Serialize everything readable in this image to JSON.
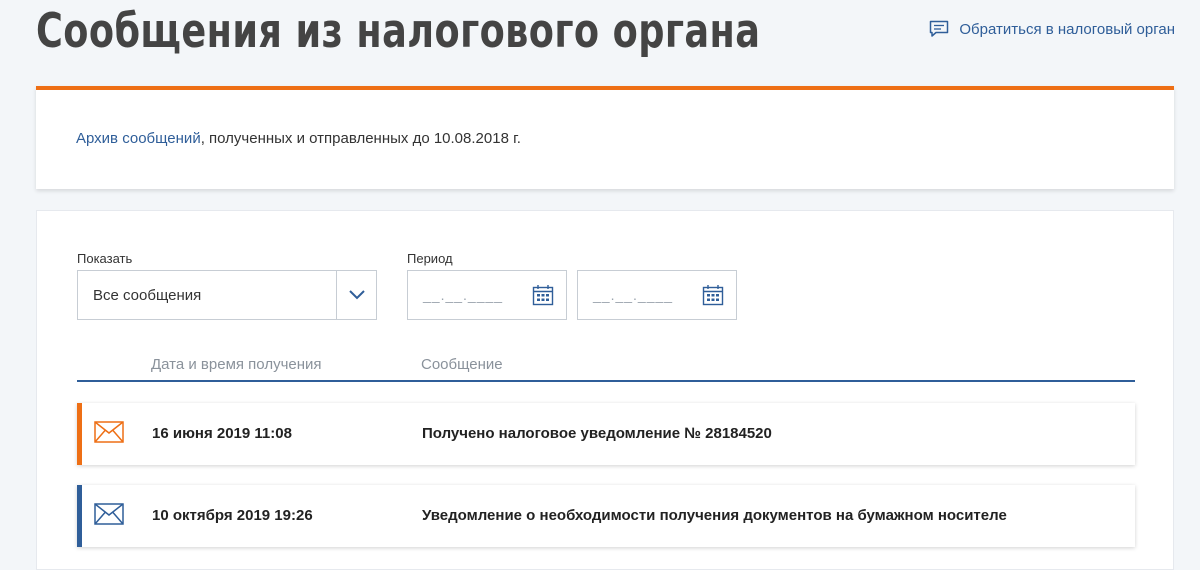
{
  "page": {
    "title": "Сообщения из налогового органа",
    "contact_link": "Обратиться в налоговый орган"
  },
  "archive": {
    "link": "Архив сообщений",
    "text": ", полученных и отправленных до 10.08.2018 г."
  },
  "filters": {
    "show_label": "Показать",
    "show_value": "Все сообщения",
    "period_label": "Период",
    "date_from_placeholder": "__.__.____",
    "date_to_placeholder": "__.__.____"
  },
  "table": {
    "columns": [
      "Дата и время получения",
      "Сообщение"
    ],
    "rows": [
      {
        "date": "16 июня 2019 11:08",
        "message": "Получено налоговое уведомление № 28184520",
        "status_color": "#ee6f15",
        "icon": "envelope-icon"
      },
      {
        "date": "10 октября 2019 19:26",
        "message": "Уведомление о необходимости получения документов на бумажном носителе",
        "status_color": "#2f5e99",
        "icon": "envelope-icon"
      }
    ]
  },
  "colors": {
    "accent_orange": "#ee6f15",
    "accent_blue": "#2f5e99"
  }
}
